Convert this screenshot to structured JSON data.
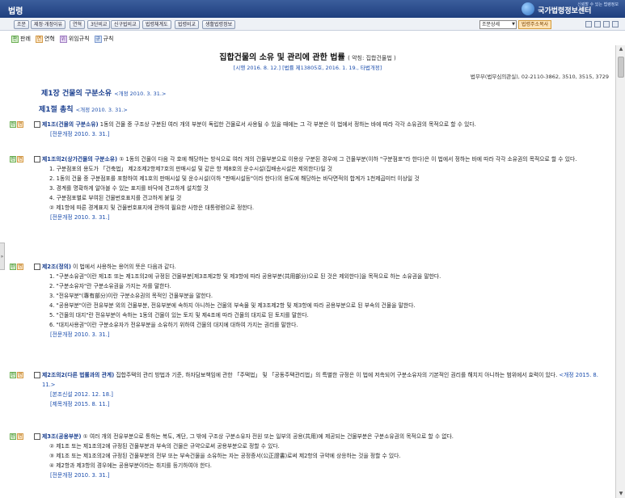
{
  "header": {
    "title": "법령",
    "logo_sub": "신뢰할 수 있는 법령정보",
    "logo_main": "국가법령정보센터"
  },
  "toolbar": {
    "buttons": [
      "조문",
      "제정·개정이유",
      "연혁",
      "3단비교",
      "신구법비교",
      "법령체계도",
      "법령비교",
      "생활법령정보"
    ],
    "select_value": "조문상세",
    "addr_button": "법령주소복사",
    "icon_names": [
      "print-icon",
      "save-icon",
      "print-preview-icon",
      "help-icon"
    ]
  },
  "legend": {
    "items": [
      {
        "mark": "판",
        "label": "판례"
      },
      {
        "mark": "연",
        "label": "연혁"
      },
      {
        "mark": "위",
        "label": "위임규칙"
      },
      {
        "mark": "규",
        "label": "규칙"
      }
    ]
  },
  "doc": {
    "title": "집합건물의 소유 및 관리에 관한 법률",
    "abbr": "( 약칭: 집합건물법 )",
    "meta": "[시행 2016. 8. 12.] [법률 제13805호, 2016. 1. 19., 타법개정]",
    "dept": "법무부(법무심의관실), 02-2110-3862, 3510, 3515, 3729",
    "ch1": "제1장 건물의 구분소유",
    "ch1_amend": "<개정 2010. 3. 31.>",
    "sec1": "제1절 총칙",
    "sec1_amend": "<개정 2010. 3. 31.>",
    "art1": {
      "head": "제1조(건물의 구분소유)",
      "text": " 1동의 건물 중 구조상 구분된 여러 개의 부분이 독립한 건물로서 사용될 수 있을 때에는 그 각 부분은 이 법에서 정하는 바에 따라 각각 소유권의 목적으로 할 수 있다.",
      "amend": "[전문개정 2010. 3. 31.]"
    },
    "art1_2": {
      "head": "제1조의2(상가건물의 구분소유)",
      "text": " ① 1동의 건물이 다음 각 호에 해당하는 방식으로 여러 개의 건물부분으로 이용상 구분된 경우에 그 건물부분(이하 \"구분점포\"라 한다)은 이 법에서 정하는 바에 따라 각각 소유권의 목적으로 할 수 있다.",
      "items": [
        "1. 구분점포의 용도가 「건축법」 제2조제2항제7호의 판매시설 및 같은 항 제8호의 운수시설(집배송시설은 제외한다)일 것",
        "2. 1동의 건물 중 구분점포를 포함하여 제1호의 판매시설 및 운수시설(이하 \"판매시설등\"이라 한다)의 용도에 해당하는 바닥면적의 합계가 1천제곱미터 이상일 것",
        "3. 경계를 명확하게 알아볼 수 있는 표지를 바닥에 견고하게 설치할 것",
        "4. 구분점포별로 부여된 건물번호표지를 견고하게 붙일 것"
      ],
      "para2": "② 제1항에 따른 경계표지 및 건물번호표지에 관하여 필요한 사항은 대통령령으로 정한다.",
      "amend": "[전문개정 2010. 3. 31.]"
    },
    "art2": {
      "head": "제2조(정의)",
      "text": " 이 법에서 사용하는 용어의 뜻은 다음과 같다.",
      "items": [
        "1. \"구분소유권\"이란 제1조 또는 제1조의2에 규정된 건물부분[제3조제2항 및 제3항에 따라 공용부분(共用部分)으로 된 것은 제외한다]을 목적으로 하는 소유권을 말한다.",
        "2. \"구분소유자\"란 구분소유권을 가지는 자를 말한다.",
        "3. \"전유부분\"(專有部分)이란 구분소유권의 목적인 건물부분을 말한다.",
        "4. \"공용부분\"이란 전유부분 외의 건물부분, 전유부분에 속하지 아니하는 건물의 부속물 및 제3조제2항 및 제3항에 따라 공용부분으로 된 부속의 건물을 말한다.",
        "5. \"건물의 대지\"란 전유부분이 속하는 1동의 건물이 있는 토지 및 제4조에 따라 건물의 대지로 된 토지를 말한다.",
        "6. \"대지사용권\"이란 구분소유자가 전유부분을 소유하기 위하여 건물의 대지에 대하여 가지는 권리를 말한다."
      ],
      "amend": "[전문개정 2010. 3. 31.]"
    },
    "art2_2": {
      "head": "제2조의2(다른 법률과의 관계)",
      "text": " 집합주택의 관리 방법과 기준, 하자담보책임에 관한 「주택법」 및 「공동주택관리법」의 특별한 규정은 이 법에 저촉되어 구분소유자의 기본적인 권리를 해치지 아니하는 범위에서 효력이 있다.",
      "text_amend": "<개정 2015. 8. 11.>",
      "amend1": "[본조신설 2012. 12. 18.]",
      "amend2": "[제목개정 2015. 8. 11.]"
    },
    "art3": {
      "head": "제3조(공용부분)",
      "text": " ① 여러 개의 전유부분으로 통하는 복도, 계단, 그 밖에 구조상 구분소유자 전원 또는 일부의 공용(共用)에 제공되는 건물부분은 구분소유권의 목적으로 할 수 없다.",
      "items": [
        "② 제1조 또는 제1조의2에 규정된 건물부분과 부속의 건물은 규약으로써 공용부분으로 정할 수 있다.",
        "③ 제1조 또는 제1조의2에 규정된 건물부분의 전부 또는 부속건물을 소유하는 자는 공정증서(公正證書)로써 제2항의 규약에 상응하는 것을 정할 수 있다.",
        "④ 제2항과 제3항의 경우에는 공용부분이라는 취지를 등기하여야 한다."
      ],
      "amend": "[전문개정 2010. 3. 31.]"
    }
  },
  "colors": {
    "header_bg": "#1f3f7e",
    "link": "#1d4fae",
    "heading": "#1a3f8f"
  }
}
